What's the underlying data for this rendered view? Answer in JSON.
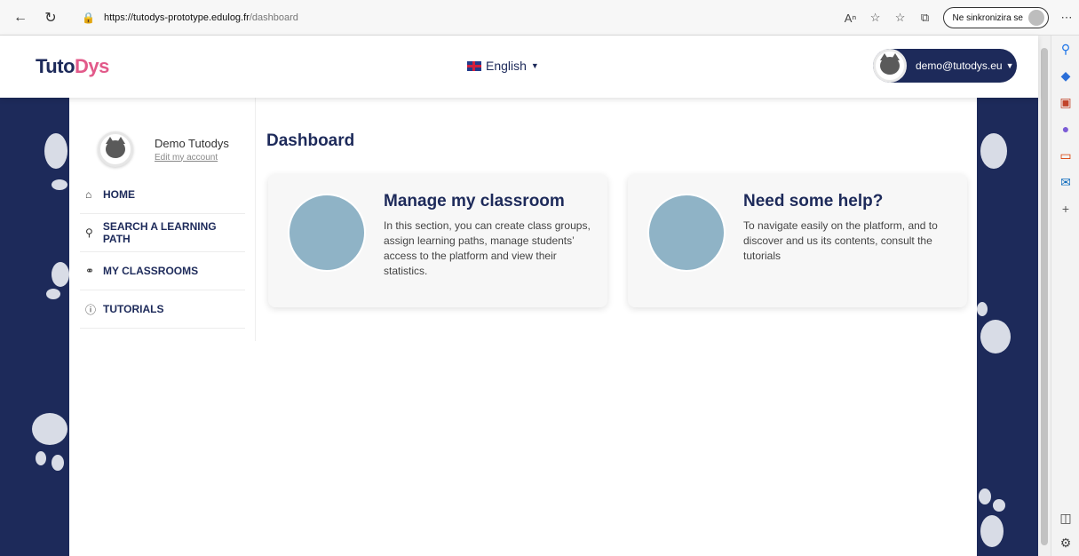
{
  "browser": {
    "url_host": "https://tutodys-prototype.edulog.fr",
    "url_path": "/dashboard",
    "sync_label": "Ne sinkronizira se"
  },
  "header": {
    "logo_main": "Tuto",
    "logo_accent": "Dys",
    "language": "English",
    "user_email": "demo@tutodys.eu"
  },
  "profile": {
    "name": "Demo Tutodys",
    "edit_link": "Edit my account"
  },
  "menu": {
    "items": [
      {
        "label": "HOME",
        "icon": "home-icon"
      },
      {
        "label": "SEARCH A LEARNING PATH",
        "icon": "search-icon"
      },
      {
        "label": "MY CLASSROOMS",
        "icon": "users-icon"
      },
      {
        "label": "TUTORIALS",
        "icon": "help-icon"
      }
    ]
  },
  "main": {
    "title": "Dashboard",
    "cards": [
      {
        "title": "Manage my classroom",
        "text": "In this section, you can create class groups, assign learning paths, manage students’ access to the platform and view their statistics."
      },
      {
        "title": "Need some help?",
        "text": "To navigate easily on the platform, and to discover and us its contents, consult the tutorials"
      }
    ]
  },
  "colors": {
    "navy": "#1d2a5a",
    "card_circle": "#8fb3c6",
    "paw": "#d8dce6"
  }
}
